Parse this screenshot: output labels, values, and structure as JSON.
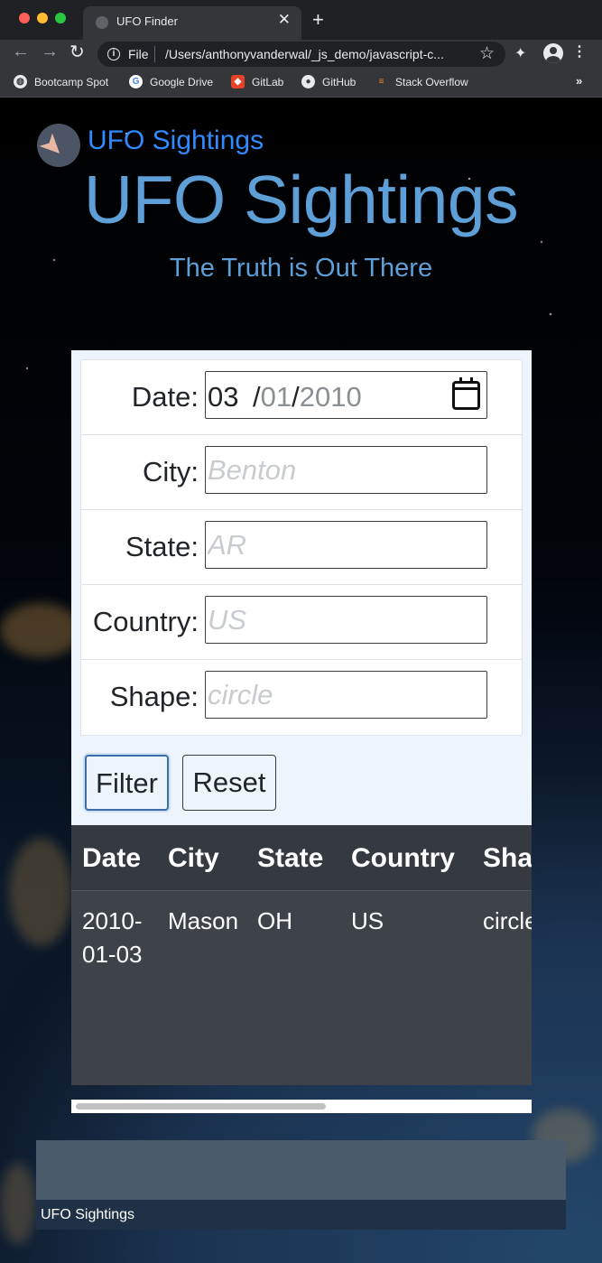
{
  "browser": {
    "tab_title": "UFO Finder",
    "url_scheme": "File",
    "url": "/Users/anthonyvanderwal/_js_demo/javascript-c...",
    "bookmarks": [
      "Bootcamp Spot",
      "Google Drive",
      "GitLab",
      "GitHub",
      "Stack Overflow"
    ],
    "bookmarks_more": "»"
  },
  "header": {
    "brand": "UFO Sightings",
    "title": "UFO Sightings",
    "subtitle": "The Truth is Out There"
  },
  "filters": {
    "date": {
      "label": "Date:",
      "month": "03",
      "day": "01",
      "year": "2010"
    },
    "city": {
      "label": "City:",
      "placeholder": "Benton"
    },
    "state": {
      "label": "State:",
      "placeholder": "AR"
    },
    "country": {
      "label": "Country:",
      "placeholder": "US"
    },
    "shape": {
      "label": "Shape:",
      "placeholder": "circle"
    }
  },
  "buttons": {
    "filter": "Filter",
    "reset": "Reset"
  },
  "table": {
    "columns": [
      "Date",
      "City",
      "State",
      "Country",
      "Sha"
    ],
    "rows": [
      {
        "date_line1": "2010-",
        "date_line2": "01-03",
        "city": "Mason",
        "state": "OH",
        "country": "US",
        "shape": "circle"
      }
    ]
  },
  "footer": {
    "text": "UFO Sightings"
  }
}
